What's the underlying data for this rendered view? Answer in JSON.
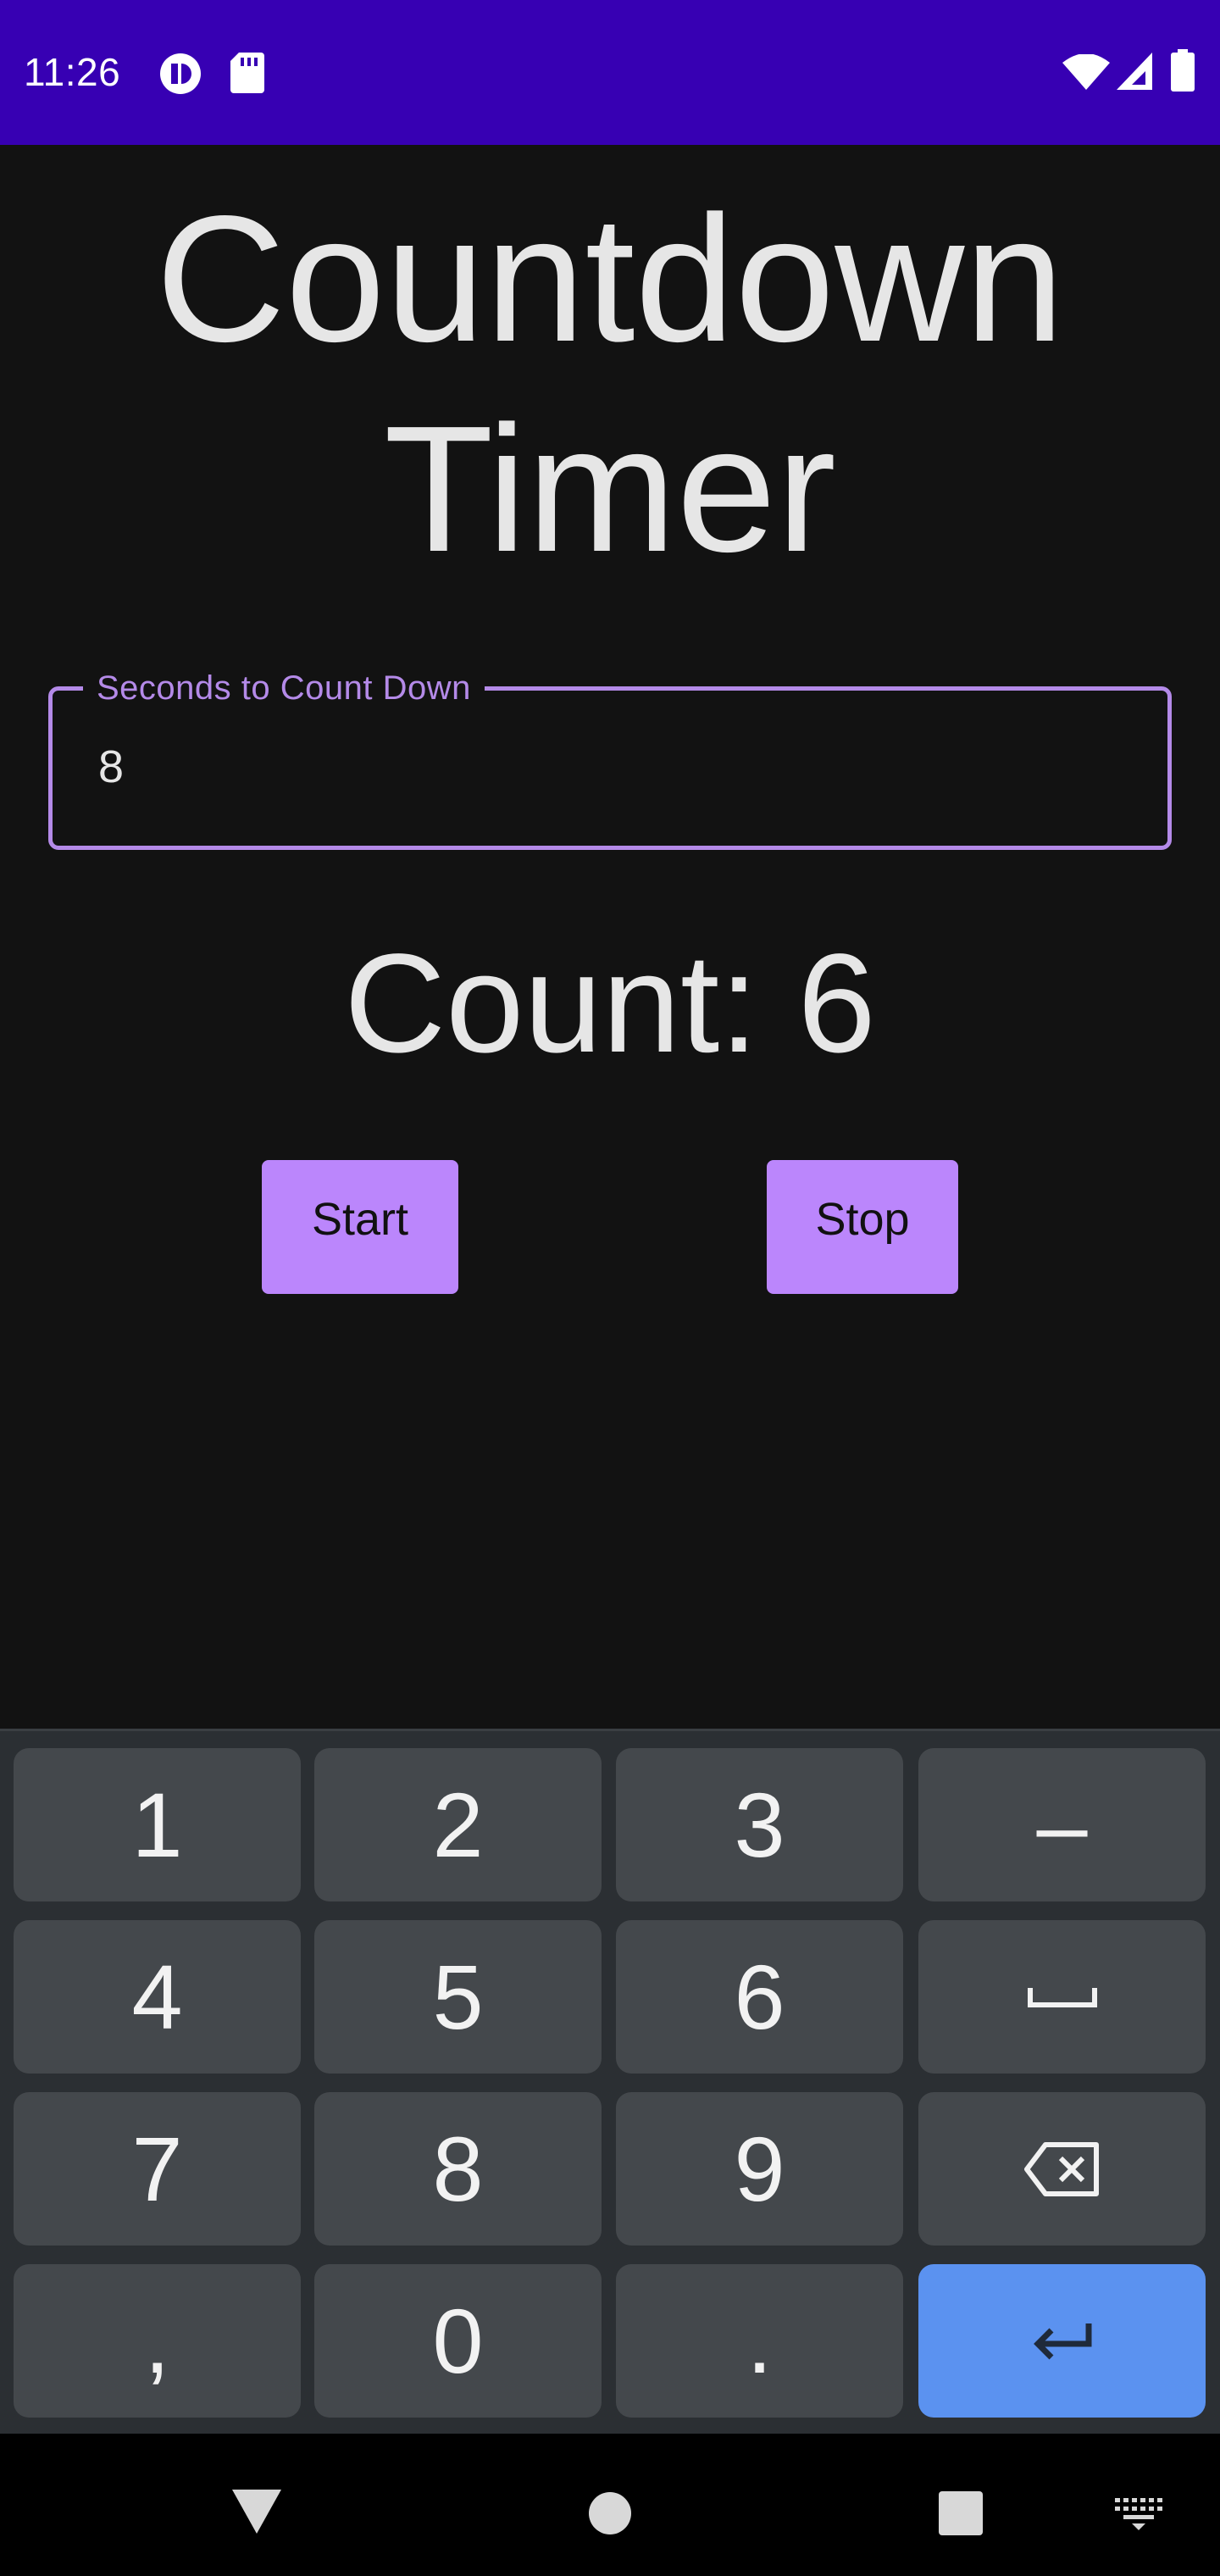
{
  "status_bar": {
    "time": "11:26",
    "left_icons": [
      "app-notification-icon",
      "sd-card-icon"
    ],
    "right_icons": [
      "wifi-icon",
      "cell-signal-icon",
      "battery-icon"
    ],
    "background": "#3700b3"
  },
  "app": {
    "title_line1": "Countdown",
    "title_line2": "Timer",
    "seconds_field": {
      "label": "Seconds to Count Down",
      "value": "8",
      "accent_color": "#b48ae8"
    },
    "count_text": "Count: 6",
    "start_label": "Start",
    "stop_label": "Stop",
    "button_color": "#bb86fc"
  },
  "keyboard": {
    "rows": [
      [
        "1",
        "2",
        "3",
        "-"
      ],
      [
        "4",
        "5",
        "6",
        "space"
      ],
      [
        "7",
        "8",
        "9",
        "backspace"
      ],
      [
        ",",
        "0",
        ".",
        "enter"
      ]
    ],
    "key_labels": {
      "k1": "1",
      "k2": "2",
      "k3": "3",
      "dash": "–",
      "k4": "4",
      "k5": "5",
      "k6": "6",
      "k7": "7",
      "k8": "8",
      "k9": "9",
      "comma": ",",
      "k0": "0",
      "period": "."
    },
    "enter_color": "#5b92f0"
  },
  "nav_bar": {
    "icons": [
      "back-icon",
      "home-icon",
      "recents-icon",
      "keyboard-switch-icon"
    ]
  }
}
